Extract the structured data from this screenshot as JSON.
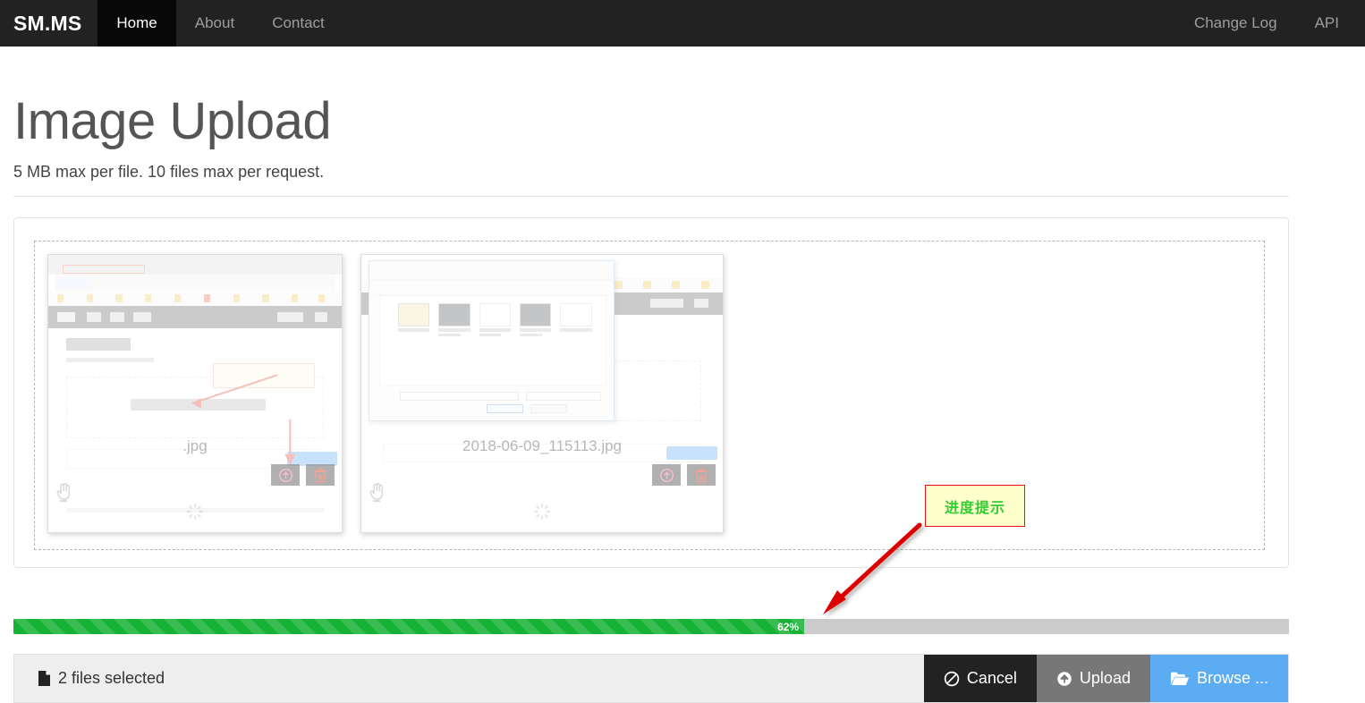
{
  "navbar": {
    "brand": "SM.MS",
    "left_links": [
      {
        "label": "Home",
        "active": true
      },
      {
        "label": "About",
        "active": false
      },
      {
        "label": "Contact",
        "active": false
      }
    ],
    "right_links": [
      {
        "label": "Change Log"
      },
      {
        "label": "API"
      }
    ]
  },
  "header": {
    "title": "Image Upload",
    "subtitle": "5 MB max per file. 10 files max per request."
  },
  "dropzone": {
    "files": [
      {
        "name": ".jpg",
        "upload_icon": "circle-arrow-up-icon",
        "delete_icon": "trash-icon",
        "cursor_icon": "hand-pointer-icon",
        "spinner_icon": "spinner-icon"
      },
      {
        "name": "2018-06-09_115113.jpg",
        "upload_icon": "circle-arrow-up-icon",
        "delete_icon": "trash-icon",
        "cursor_icon": "hand-pointer-icon",
        "spinner_icon": "spinner-icon"
      }
    ]
  },
  "annotation": {
    "text": "进度提示",
    "box_fill": "#ffffcc",
    "box_border": "#ee1111",
    "text_color": "#33cc33",
    "arrow_color": "#dd0000"
  },
  "progress": {
    "percent": 62,
    "label": "62%",
    "fill_color": "#16b236",
    "track_color": "#cccccc"
  },
  "toolbar": {
    "status_icon": "file-icon",
    "status_text": "2 files selected",
    "cancel_label": "Cancel",
    "cancel_icon": "ban-icon",
    "upload_label": "Upload",
    "upload_icon": "circle-arrow-up-icon",
    "browse_label": "Browse ...",
    "browse_icon": "folder-open-icon",
    "browse_color": "#5bacf2"
  }
}
